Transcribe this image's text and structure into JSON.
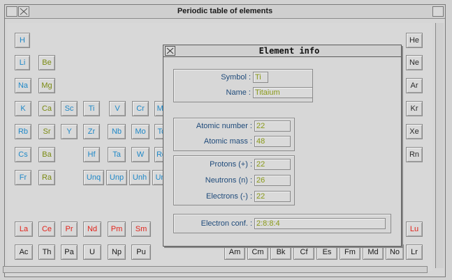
{
  "window": {
    "title": "Periodic table of elements"
  },
  "elements": [
    {
      "id": "H",
      "symbol": "H",
      "color": "c"
    },
    {
      "id": "He",
      "symbol": "He",
      "color": "s"
    },
    {
      "id": "Li",
      "symbol": "Li",
      "color": "c"
    },
    {
      "id": "Be",
      "symbol": "Be",
      "color": "g"
    },
    {
      "id": "Ne",
      "symbol": "Ne",
      "color": "s"
    },
    {
      "id": "Na",
      "symbol": "Na",
      "color": "c"
    },
    {
      "id": "Mg",
      "symbol": "Mg",
      "color": "g"
    },
    {
      "id": "Ar",
      "symbol": "Ar",
      "color": "s"
    },
    {
      "id": "K",
      "symbol": "K",
      "color": "c"
    },
    {
      "id": "Ca",
      "symbol": "Ca",
      "color": "g"
    },
    {
      "id": "Sc",
      "symbol": "Sc",
      "color": "c"
    },
    {
      "id": "Ti",
      "symbol": "Ti",
      "color": "c"
    },
    {
      "id": "V",
      "symbol": "V",
      "color": "c"
    },
    {
      "id": "Cr",
      "symbol": "Cr",
      "color": "c"
    },
    {
      "id": "Mn",
      "symbol": "Mr",
      "color": "c"
    },
    {
      "id": "Kr",
      "symbol": "Kr",
      "color": "s"
    },
    {
      "id": "Rb",
      "symbol": "Rb",
      "color": "c"
    },
    {
      "id": "Sr",
      "symbol": "Sr",
      "color": "g"
    },
    {
      "id": "Y",
      "symbol": "Y",
      "color": "c"
    },
    {
      "id": "Zr",
      "symbol": "Zr",
      "color": "c"
    },
    {
      "id": "Nb",
      "symbol": "Nb",
      "color": "c"
    },
    {
      "id": "Mo",
      "symbol": "Mo",
      "color": "c"
    },
    {
      "id": "Tc",
      "symbol": "Tc",
      "color": "c"
    },
    {
      "id": "Xe",
      "symbol": "Xe",
      "color": "s"
    },
    {
      "id": "Cs",
      "symbol": "Cs",
      "color": "c"
    },
    {
      "id": "Ba",
      "symbol": "Ba",
      "color": "g"
    },
    {
      "id": "Hf",
      "symbol": "Hf",
      "color": "c"
    },
    {
      "id": "Ta",
      "symbol": "Ta",
      "color": "c"
    },
    {
      "id": "W",
      "symbol": "W",
      "color": "c"
    },
    {
      "id": "Re",
      "symbol": "Re",
      "color": "c"
    },
    {
      "id": "Rn",
      "symbol": "Rn",
      "color": "s"
    },
    {
      "id": "Fr",
      "symbol": "Fr",
      "color": "c"
    },
    {
      "id": "Ra",
      "symbol": "Ra",
      "color": "g"
    },
    {
      "id": "Unq",
      "symbol": "Unq",
      "color": "c"
    },
    {
      "id": "Unp",
      "symbol": "Unp",
      "color": "c"
    },
    {
      "id": "Unh",
      "symbol": "Unh",
      "color": "c"
    },
    {
      "id": "Uns",
      "symbol": "Un",
      "color": "c"
    },
    {
      "id": "La",
      "symbol": "La",
      "color": "r"
    },
    {
      "id": "Ce",
      "symbol": "Ce",
      "color": "r"
    },
    {
      "id": "Pr",
      "symbol": "Pr",
      "color": "r"
    },
    {
      "id": "Nd",
      "symbol": "Nd",
      "color": "r"
    },
    {
      "id": "Pm",
      "symbol": "Pm",
      "color": "r"
    },
    {
      "id": "Sm",
      "symbol": "Sm",
      "color": "r"
    },
    {
      "id": "Lu",
      "symbol": "Lu",
      "color": "r"
    },
    {
      "id": "Ac",
      "symbol": "Ac",
      "color": "b"
    },
    {
      "id": "Th",
      "symbol": "Th",
      "color": "b"
    },
    {
      "id": "Pa",
      "symbol": "Pa",
      "color": "b"
    },
    {
      "id": "U",
      "symbol": "U",
      "color": "b"
    },
    {
      "id": "Np",
      "symbol": "Np",
      "color": "b"
    },
    {
      "id": "Pu",
      "symbol": "Pu",
      "color": "b"
    },
    {
      "id": "Am",
      "symbol": "Am",
      "color": "b"
    },
    {
      "id": "Cm",
      "symbol": "Cm",
      "color": "b"
    },
    {
      "id": "Bk",
      "symbol": "Bk",
      "color": "b"
    },
    {
      "id": "Cf",
      "symbol": "Cf",
      "color": "b"
    },
    {
      "id": "Es",
      "symbol": "Es",
      "color": "b"
    },
    {
      "id": "Fm",
      "symbol": "Fm",
      "color": "b"
    },
    {
      "id": "Md",
      "symbol": "Md",
      "color": "b"
    },
    {
      "id": "No",
      "symbol": "No",
      "color": "b"
    },
    {
      "id": "Lr",
      "symbol": "Lr",
      "color": "b"
    }
  ],
  "dialog": {
    "title": "Element info",
    "symbol_label": "Symbol :",
    "symbol_value": "Ti",
    "name_label": "Name :",
    "name_value": "Titaium",
    "atomic_number_label": "Atomic number :",
    "atomic_number_value": "22",
    "atomic_mass_label": "Atomic mass :",
    "atomic_mass_value": "48",
    "protons_label": "Protons (+) :",
    "protons_value": "22",
    "neutrons_label": "Neutrons (n) :",
    "neutrons_value": "26",
    "electrons_label": "Electrons (-) :",
    "electrons_value": "22",
    "econf_label": "Electron conf. :",
    "econf_value": "2:8:8:4"
  },
  "colors": {
    "cyan": "#1e88c8",
    "olive": "#7a8a10",
    "red": "#e2231a",
    "black": "#1a1a1a",
    "noble": "#2a2a2a"
  },
  "icons": {
    "close": "close-icon",
    "toggle_size": "toggle-size-icon"
  }
}
